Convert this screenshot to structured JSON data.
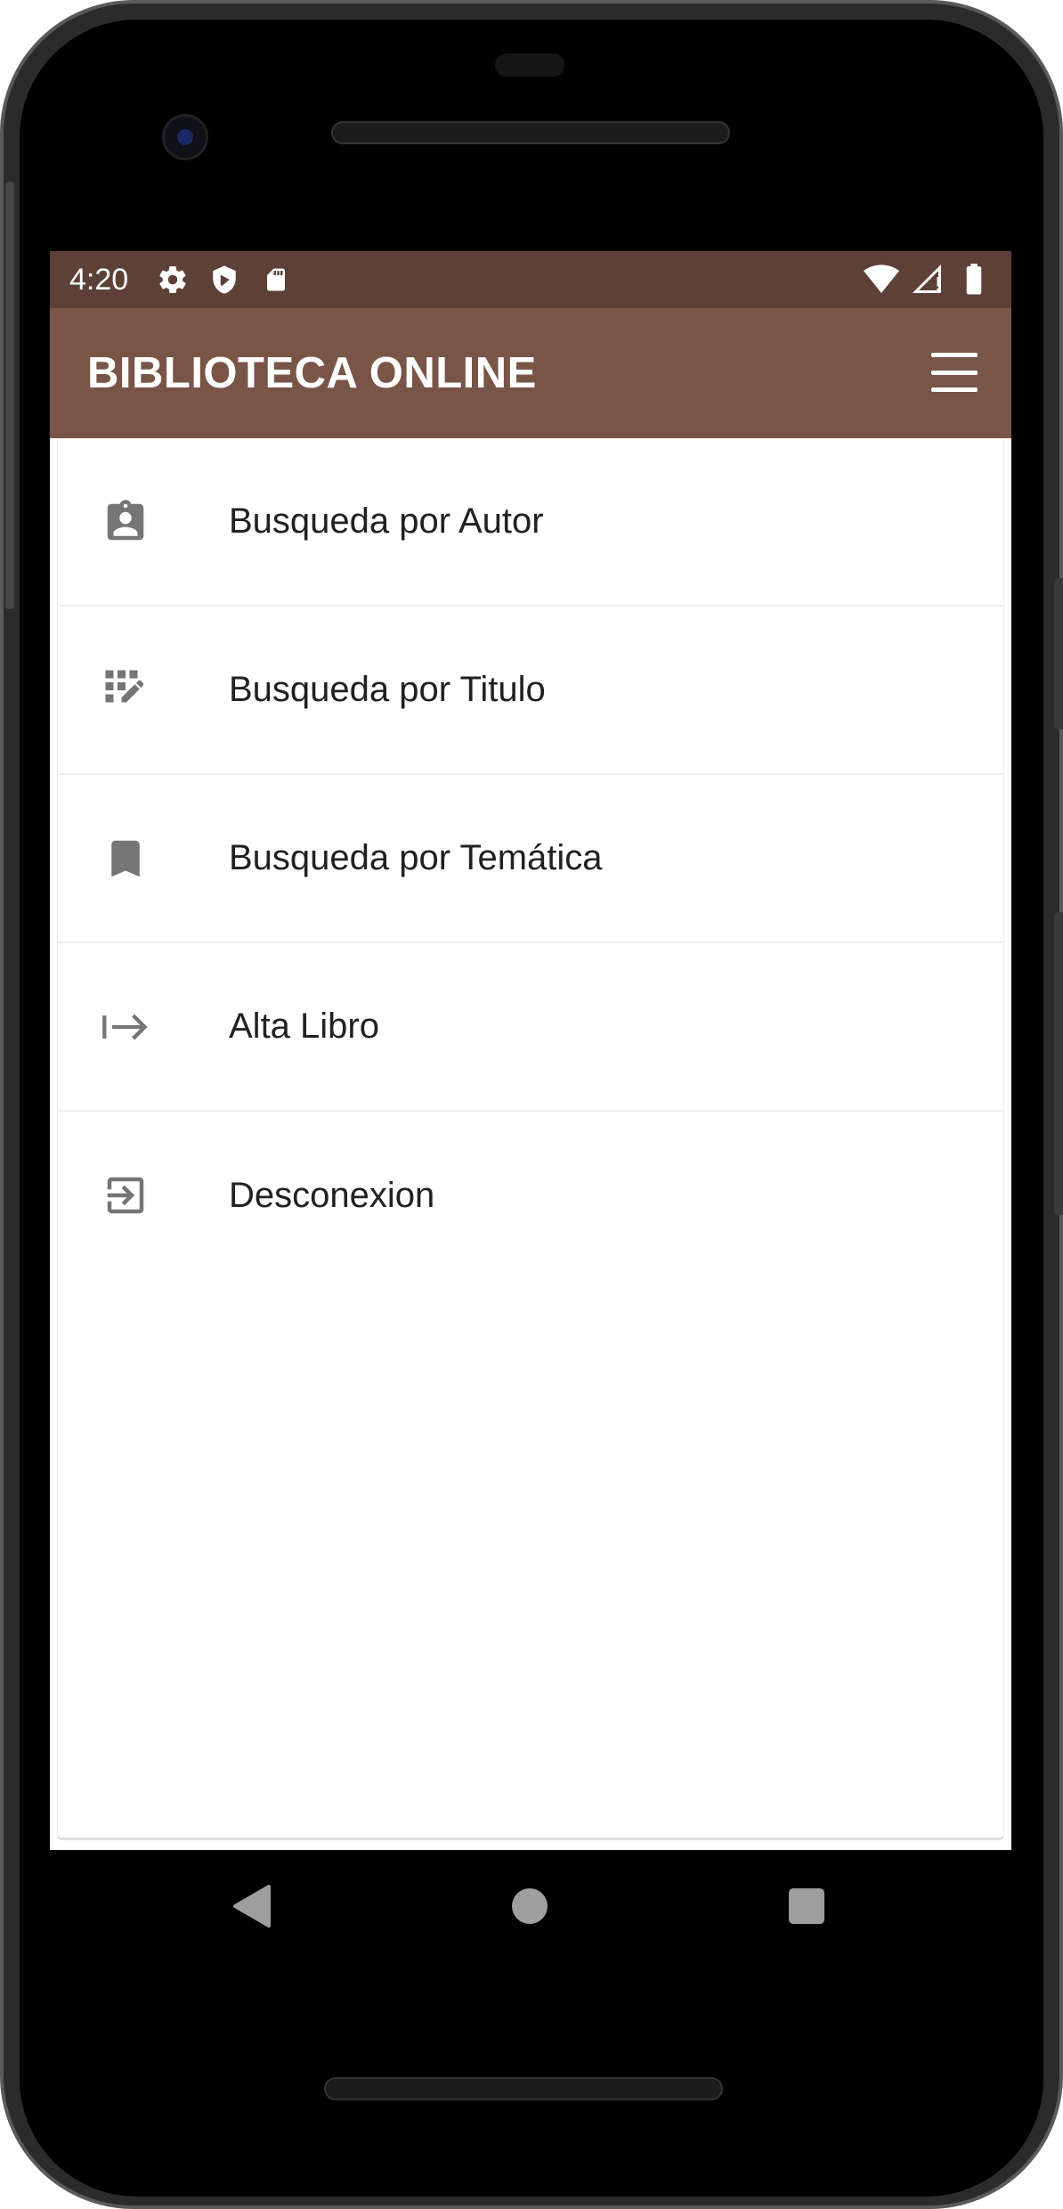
{
  "status_bar": {
    "time": "4:20",
    "left_icons": [
      "settings-icon",
      "shield-icon",
      "sd-card-icon"
    ],
    "right_icons": [
      "wifi-icon",
      "cell-signal-icon",
      "battery-icon"
    ],
    "color": "#5d4037"
  },
  "app_bar": {
    "title": "BIBLIOTECA ONLINE",
    "menu_icon": "hamburger-menu-icon",
    "color": "#795548"
  },
  "menu": {
    "items": [
      {
        "label": "Busqueda por Autor",
        "icon": "assignment-ind-icon"
      },
      {
        "label": "Busqueda por Titulo",
        "icon": "grid-edit-icon"
      },
      {
        "label": "Busqueda por Temática",
        "icon": "bookmark-icon"
      },
      {
        "label": "Alta Libro",
        "icon": "arrow-to-right-icon"
      },
      {
        "label": "Desconexion",
        "icon": "exit-to-app-icon"
      }
    ],
    "icon_color": "#757575",
    "text_color": "#212121"
  },
  "nav_bar": {
    "buttons": [
      "back",
      "home",
      "recents"
    ],
    "color": "#9e9e9e"
  }
}
